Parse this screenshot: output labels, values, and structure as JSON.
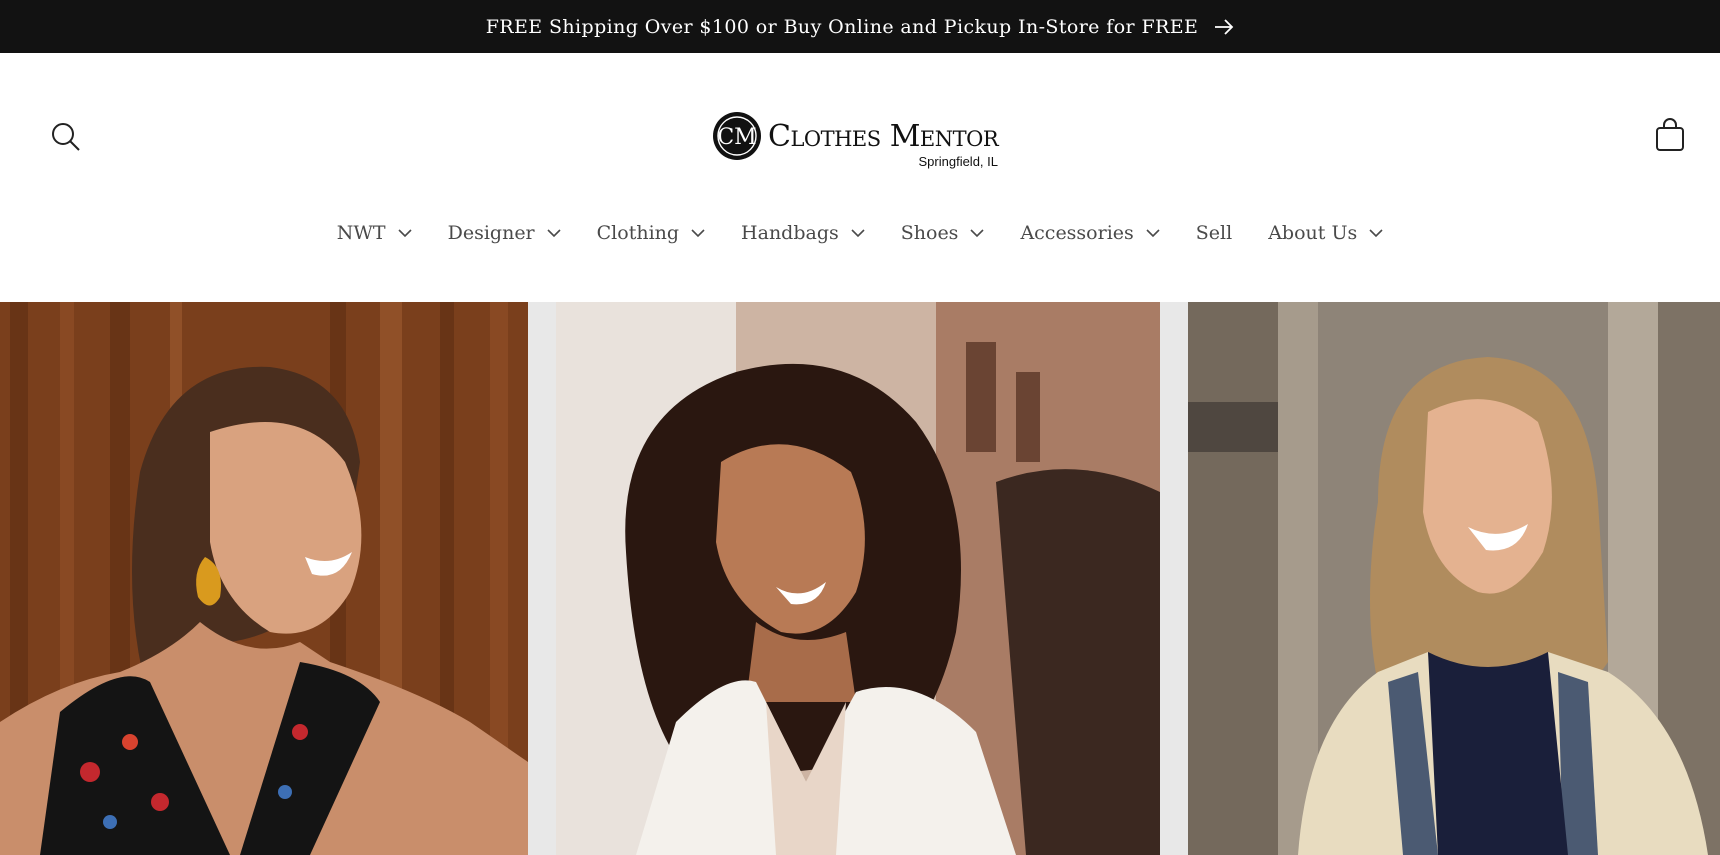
{
  "announcement": {
    "text": "FREE Shipping Over $100 or Buy Online and Pickup In-Store for FREE",
    "arrow_icon": "arrow-right-icon"
  },
  "header": {
    "search_icon": "search-icon",
    "cart_icon": "cart-icon",
    "logo": {
      "monogram": "CM",
      "name": "Clothes Mentor",
      "location": "Springfield, IL"
    }
  },
  "nav": {
    "items": [
      {
        "label": "NWT",
        "has_dropdown": true
      },
      {
        "label": "Designer",
        "has_dropdown": true
      },
      {
        "label": "Clothing",
        "has_dropdown": true
      },
      {
        "label": "Handbags",
        "has_dropdown": true
      },
      {
        "label": "Shoes",
        "has_dropdown": true
      },
      {
        "label": "Accessories",
        "has_dropdown": true
      },
      {
        "label": "Sell",
        "has_dropdown": false
      },
      {
        "label": "About Us",
        "has_dropdown": true
      }
    ]
  },
  "colors": {
    "announcement_bg": "#121212",
    "announcement_text": "#ffffff",
    "nav_text": "#4a4a4a",
    "hero_gap": "#e8e8e8"
  }
}
